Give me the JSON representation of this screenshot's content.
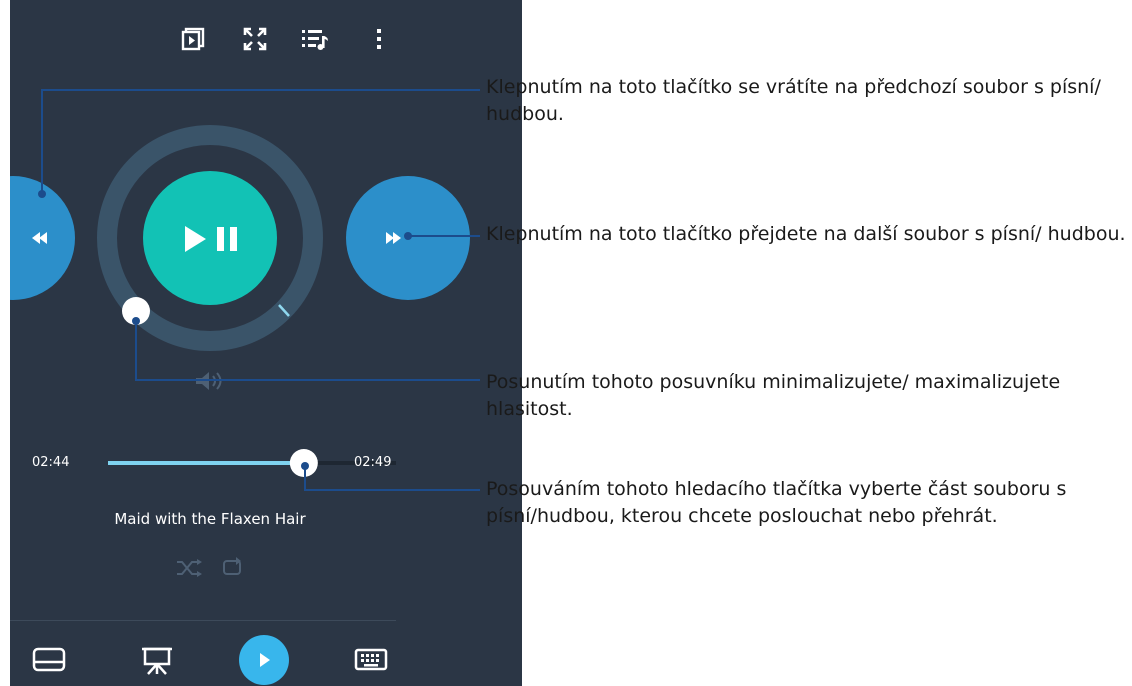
{
  "player": {
    "time_elapsed": "02:44",
    "time_total": "02:49",
    "song_title": "Maid with the Flaxen Hair",
    "seek_progress": 0.96,
    "colors": {
      "background": "#2b3645",
      "play_button": "#12c2b5",
      "nav_button": "#2c8fca",
      "ring": "#3a5469",
      "accent": "#38b6ec"
    }
  },
  "top_icons": [
    "cast-icon",
    "fullscreen-icon",
    "playlist-icon",
    "more-vert-icon"
  ],
  "bottom_bar": [
    "touchpad-icon",
    "presentation-icon",
    "play-icon",
    "keyboard-icon"
  ],
  "annotations": {
    "previous": "Klepnutím na toto tlačítko se vrátíte na předchozí soubor s písní/ hudbou.",
    "next": "Klepnutím na toto tlačítko přejdete na další soubor s písní/ hudbou.",
    "volume": "Posunutím tohoto posuvníku minimalizujete/ maximalizujete hlasitost.",
    "seek": "Posouváním tohoto hledacího tlačítka vyberte část souboru s písní/hudbou, kterou chcete poslouchat nebo přehrát."
  }
}
